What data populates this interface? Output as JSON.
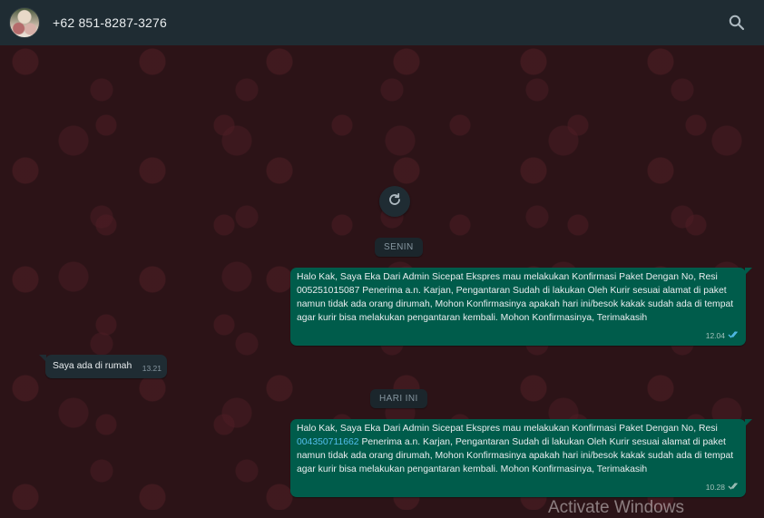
{
  "header": {
    "contact_name": "+62 851-8287-3276",
    "avatar_icon": "profile-photo",
    "search_icon": "search-icon"
  },
  "theme": {
    "header_bg": "#1f2c33",
    "chat_bg": "#2c1317",
    "outgoing_bubble": "#005c4b",
    "incoming_bubble": "#1f2c33",
    "link_color": "#53bdeb",
    "read_tick_color": "#53bdeb"
  },
  "chat": {
    "refresh_icon": "refresh-icon",
    "date_chips": [
      "SENIN",
      "HARI INI"
    ],
    "messages": [
      {
        "direction": "out",
        "pre": "Halo Kak, Saya Eka Dari Admin Sicepat Ekspres mau melakukan Konfirmasi Paket Dengan No, Resi 005251015087 Penerima a.n. Karjan, Pengantaran Sudah di lakukan Oleh Kurir sesuai alamat di paket namun tidak ada orang dirumah, Mohon Konfirmasinya apakah hari ini/besok kakak sudah ada di tempat agar kurir bisa melakukan pengantaran kembali. Mohon Konfirmasinya, Terimakasih",
        "link": "",
        "post": "",
        "time": "12.04"
      },
      {
        "direction": "in",
        "pre": "Saya ada di rumah",
        "time": "13.21"
      },
      {
        "direction": "out",
        "pre": "Halo Kak, Saya Eka Dari Admin Sicepat Ekspres mau melakukan Konfirmasi Paket Dengan No, Resi ",
        "link": "004350711662",
        "post": " Penerima a.n. Karjan, Pengantaran Sudah di lakukan Oleh Kurir sesuai alamat di paket namun tidak ada orang dirumah, Mohon Konfirmasinya apakah hari ini/besok kakak sudah ada di tempat agar kurir bisa melakukan pengantaran kembali. Mohon Konfirmasinya, Terimakasih",
        "time": "10.28"
      }
    ]
  },
  "watermark": "Activate Windows"
}
